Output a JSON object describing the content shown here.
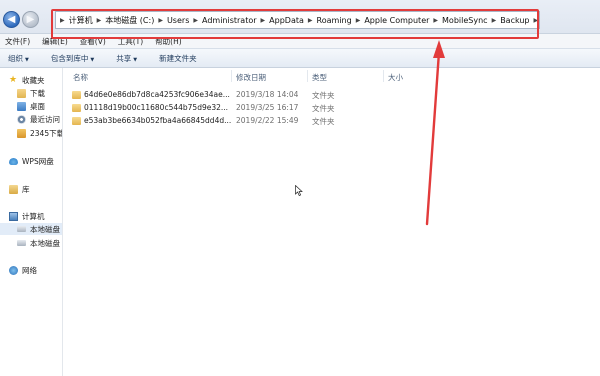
{
  "address_bar": {
    "crumbs": [
      "计算机",
      "本地磁盘 (C:)",
      "Users",
      "Administrator",
      "AppData",
      "Roaming",
      "Apple Computer",
      "MobileSync",
      "Backup"
    ]
  },
  "menu": {
    "items": [
      "文件(F)",
      "编辑(E)",
      "查看(V)",
      "工具(T)",
      "帮助(H)"
    ]
  },
  "toolbar": {
    "organize": "组织",
    "include_in_library": "包含到库中",
    "share": "共享",
    "new_folder": "新建文件夹"
  },
  "nav": {
    "favorites": "收藏夹",
    "downloads": "下载",
    "desktop": "桌面",
    "recent": "最近访问",
    "dl2345": "2345下载",
    "wps": "WPS网盘",
    "library": "库",
    "computer": "计算机",
    "drive_c": "本地磁盘",
    "drive_d": "本地磁盘",
    "network": "网络"
  },
  "columns": {
    "name": "名称",
    "modified": "修改日期",
    "type": "类型",
    "size": "大小"
  },
  "files": [
    {
      "name": "64d6e0e86db7d8ca4253fc906e34ae...",
      "modified": "2019/3/18 14:04",
      "type": "文件夹"
    },
    {
      "name": "01118d19b00c11680c544b75d9e32...",
      "modified": "2019/3/25 16:17",
      "type": "文件夹"
    },
    {
      "name": "e53ab3be6634b052fba4a66845dd4d...",
      "modified": "2019/2/22 15:49",
      "type": "文件夹"
    }
  ],
  "colors": {
    "highlight": "#e23b3b",
    "annotation_arrow": "#e23b3b"
  }
}
